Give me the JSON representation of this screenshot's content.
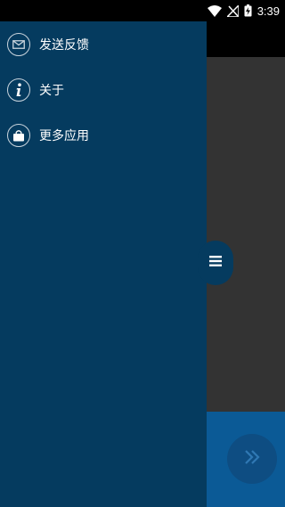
{
  "status_bar": {
    "time": "3:39",
    "icons": [
      "wifi-icon",
      "signal-icon",
      "battery-charging-icon"
    ]
  },
  "drawer": {
    "items": [
      {
        "label": "发送反馈",
        "icon": "mail-icon"
      },
      {
        "label": "关于",
        "icon": "info-icon"
      },
      {
        "label": "更多应用",
        "icon": "shopping-bag-icon"
      }
    ]
  },
  "handle": {
    "icon": "menu-icon"
  },
  "fab": {
    "icon": "double-chevron-right-icon"
  },
  "colors": {
    "drawer_bg": "#053b5f",
    "status_bar_bg": "#000000",
    "content_bg": "#333333",
    "bottom_bar_bg": "#0b5a96",
    "fab_bg": "#0e4d82"
  }
}
